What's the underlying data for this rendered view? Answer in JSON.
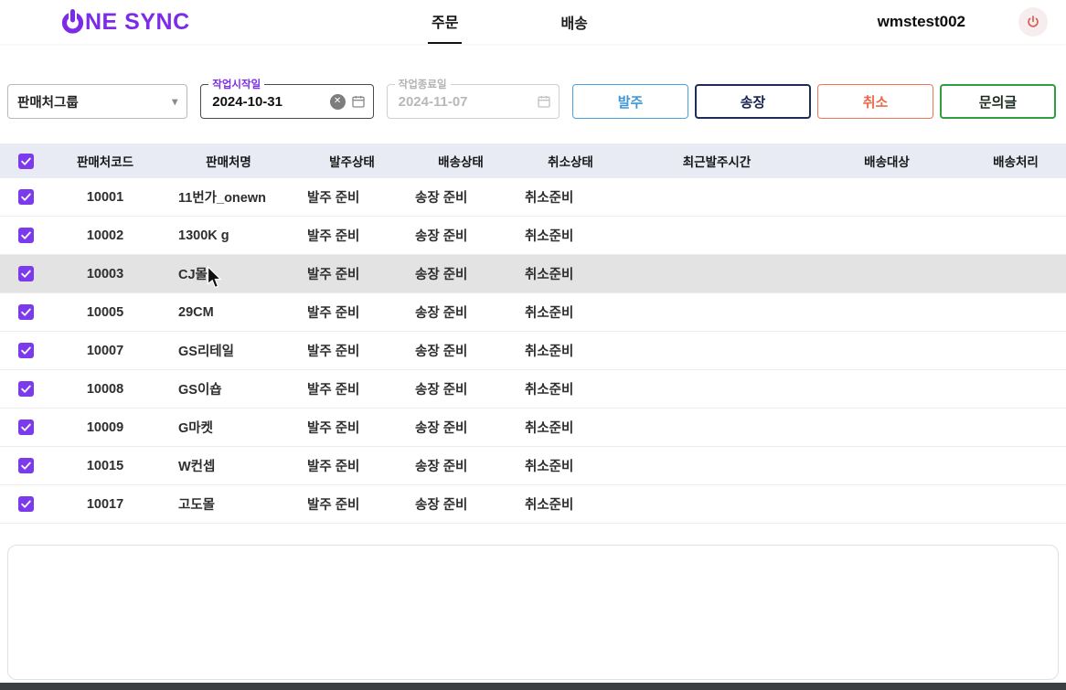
{
  "header": {
    "logo": {
      "full": "ONE SYNC",
      "rest": "NE SYNC"
    },
    "tabs": [
      {
        "label": "주문",
        "active": true
      },
      {
        "label": "배송",
        "active": false
      }
    ],
    "username": "wmstest002"
  },
  "filters": {
    "seller_group_select": {
      "value": "판매처그룹"
    },
    "start_date": {
      "label": "작업시작일",
      "value": "2024-10-31"
    },
    "end_date": {
      "label": "작업종료일",
      "value": "2024-11-07"
    },
    "buttons": [
      {
        "label": "발주"
      },
      {
        "label": "송장"
      },
      {
        "label": "취소"
      },
      {
        "label": "문의글"
      }
    ]
  },
  "table": {
    "columns": [
      "판매처코드",
      "판매처명",
      "발주상태",
      "배송상태",
      "취소상태",
      "최근발주시간",
      "배송대상",
      "배송처리"
    ],
    "rows": [
      {
        "code": "10001",
        "name": "11번가_onewn",
        "order_status": "발주 준비",
        "ship_status": "송장 준비",
        "cancel_status": "취소준비",
        "checked": true,
        "highlight": false
      },
      {
        "code": "10002",
        "name": "1300K g",
        "order_status": "발주 준비",
        "ship_status": "송장 준비",
        "cancel_status": "취소준비",
        "checked": true,
        "highlight": false
      },
      {
        "code": "10003",
        "name": "CJ몰",
        "order_status": "발주 준비",
        "ship_status": "송장 준비",
        "cancel_status": "취소준비",
        "checked": true,
        "highlight": true
      },
      {
        "code": "10005",
        "name": "29CM",
        "order_status": "발주 준비",
        "ship_status": "송장 준비",
        "cancel_status": "취소준비",
        "checked": true,
        "highlight": false
      },
      {
        "code": "10007",
        "name": "GS리테일",
        "order_status": "발주 준비",
        "ship_status": "송장 준비",
        "cancel_status": "취소준비",
        "checked": true,
        "highlight": false
      },
      {
        "code": "10008",
        "name": "GS이숍",
        "order_status": "발주 준비",
        "ship_status": "송장 준비",
        "cancel_status": "취소준비",
        "checked": true,
        "highlight": false
      },
      {
        "code": "10009",
        "name": "G마켓",
        "order_status": "발주 준비",
        "ship_status": "송장 준비",
        "cancel_status": "취소준비",
        "checked": true,
        "highlight": false
      },
      {
        "code": "10015",
        "name": "W컨셉",
        "order_status": "발주 준비",
        "ship_status": "송장 준비",
        "cancel_status": "취소준비",
        "checked": true,
        "highlight": false
      },
      {
        "code": "10017",
        "name": "고도몰",
        "order_status": "발주 준비",
        "ship_status": "송장 준비",
        "cancel_status": "취소준비",
        "checked": true,
        "highlight": false
      }
    ]
  },
  "colors": {
    "brand_purple": "#7c2ce8",
    "button_order_blue": "#4aa3df",
    "button_invoice_navy": "#1f2b5b",
    "button_cancel_coral": "#f0765a",
    "button_inquiry_green": "#2f9e41",
    "checkbox_purple": "#7c3aed",
    "table_header_bg": "#e9ebf4",
    "row_highlight": "#e3e3e3"
  }
}
